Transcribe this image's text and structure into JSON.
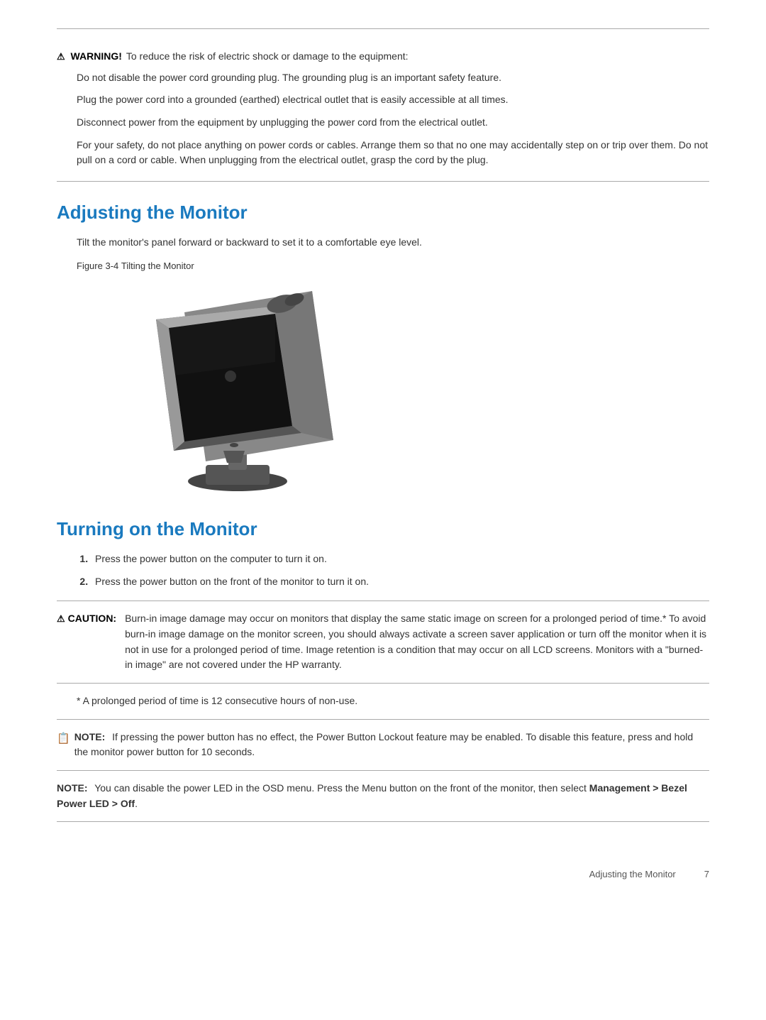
{
  "warning": {
    "triangle_symbol": "⚠",
    "label": "WARNING!",
    "intro": "To reduce the risk of electric shock or damage to the equipment:",
    "paragraphs": [
      "Do not disable the power cord grounding plug. The grounding plug is an important safety feature.",
      "Plug the power cord into a grounded (earthed) electrical outlet that is easily accessible at all times.",
      "Disconnect power from the equipment by unplugging the power cord from the electrical outlet.",
      "For your safety, do not place anything on power cords or cables. Arrange them so that no one may accidentally step on or trip over them. Do not pull on a cord or cable. When unplugging from the electrical outlet, grasp the cord by the plug."
    ]
  },
  "section1": {
    "title": "Adjusting the Monitor",
    "body": "Tilt the monitor's panel forward or backward to set it to a comfortable eye level.",
    "figure_label": "Figure 3-4",
    "figure_caption": "Tilting the Monitor"
  },
  "section2": {
    "title": "Turning on the Monitor",
    "steps": [
      "Press the power button on the computer to turn it on.",
      "Press the power button on the front of the monitor to turn it on."
    ],
    "caution_label": "CAUTION:",
    "caution_triangle": "⚠",
    "caution_text": "Burn-in image damage may occur on monitors that display the same static image on screen for a prolonged period of time.* To avoid burn-in image damage on the monitor screen, you should always activate a screen saver application or turn off the monitor when it is not in use for a prolonged period of time. Image retention is a condition that may occur on all LCD screens. Monitors with a \"burned-in image\" are not covered under the HP warranty.",
    "prolonged_note": "* A prolonged period of time is 12 consecutive hours of non-use.",
    "note1_icon": "📝",
    "note1_label": "NOTE:",
    "note1_text": "If pressing the power button has no effect, the Power Button Lockout feature may be enabled. To disable this feature, press and hold the monitor power button for 10 seconds.",
    "note2_label": "NOTE:",
    "note2_text_part1": "You can disable the power LED in the OSD menu. Press the Menu button on the front of the monitor, then select ",
    "note2_bold": "Management > Bezel Power LED > Off",
    "note2_text_part2": "."
  },
  "footer": {
    "section": "Adjusting the Monitor",
    "page": "7"
  }
}
